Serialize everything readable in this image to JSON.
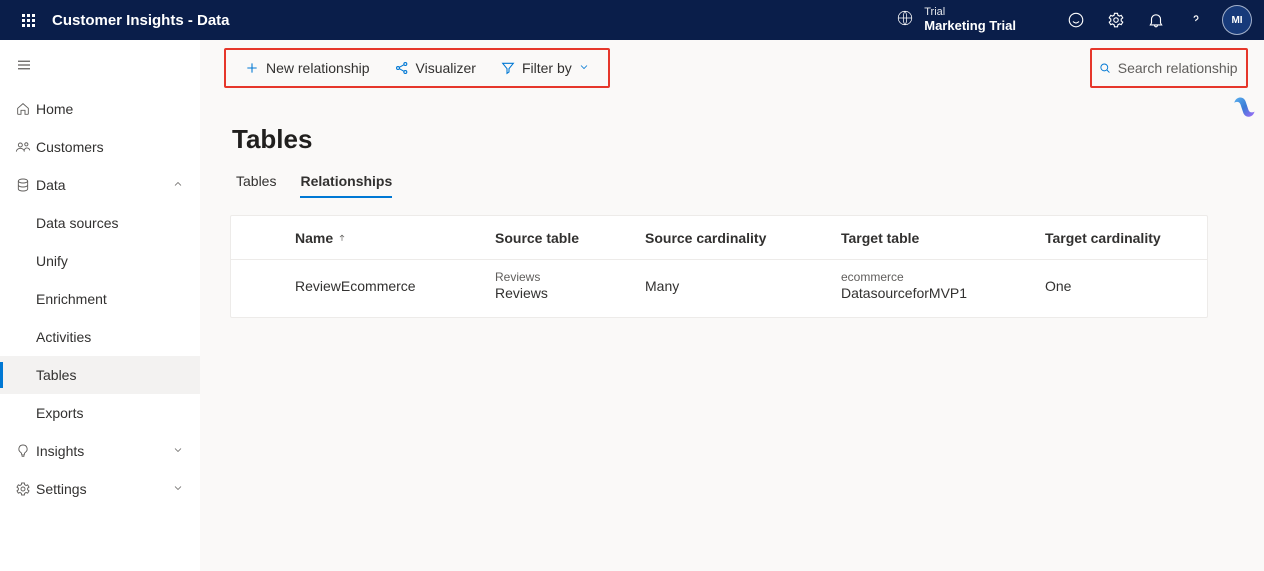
{
  "header": {
    "app_title": "Customer Insights - Data",
    "trial_label": "Trial",
    "trial_name": "Marketing Trial",
    "avatar_initials": "MI"
  },
  "sidebar": {
    "home": "Home",
    "customers": "Customers",
    "data": "Data",
    "data_children": {
      "data_sources": "Data sources",
      "unify": "Unify",
      "enrichment": "Enrichment",
      "activities": "Activities",
      "tables": "Tables",
      "exports": "Exports"
    },
    "insights": "Insights",
    "settings": "Settings"
  },
  "cmdbar": {
    "new_relationship": "New relationship",
    "visualizer": "Visualizer",
    "filter_by": "Filter by",
    "search_placeholder": "Search relationships"
  },
  "page": {
    "title": "Tables",
    "tabs": {
      "tables": "Tables",
      "relationships": "Relationships"
    }
  },
  "table": {
    "cols": {
      "name": "Name",
      "source_table": "Source table",
      "source_card": "Source cardinality",
      "target_table": "Target table",
      "target_card": "Target cardinality"
    },
    "rows": [
      {
        "name": "ReviewEcommerce",
        "src_ds": "Reviews",
        "src_tbl": "Reviews",
        "src_card": "Many",
        "tgt_ds": "ecommerce",
        "tgt_tbl": "DatasourceforMVP1",
        "tgt_card": "One"
      }
    ]
  }
}
